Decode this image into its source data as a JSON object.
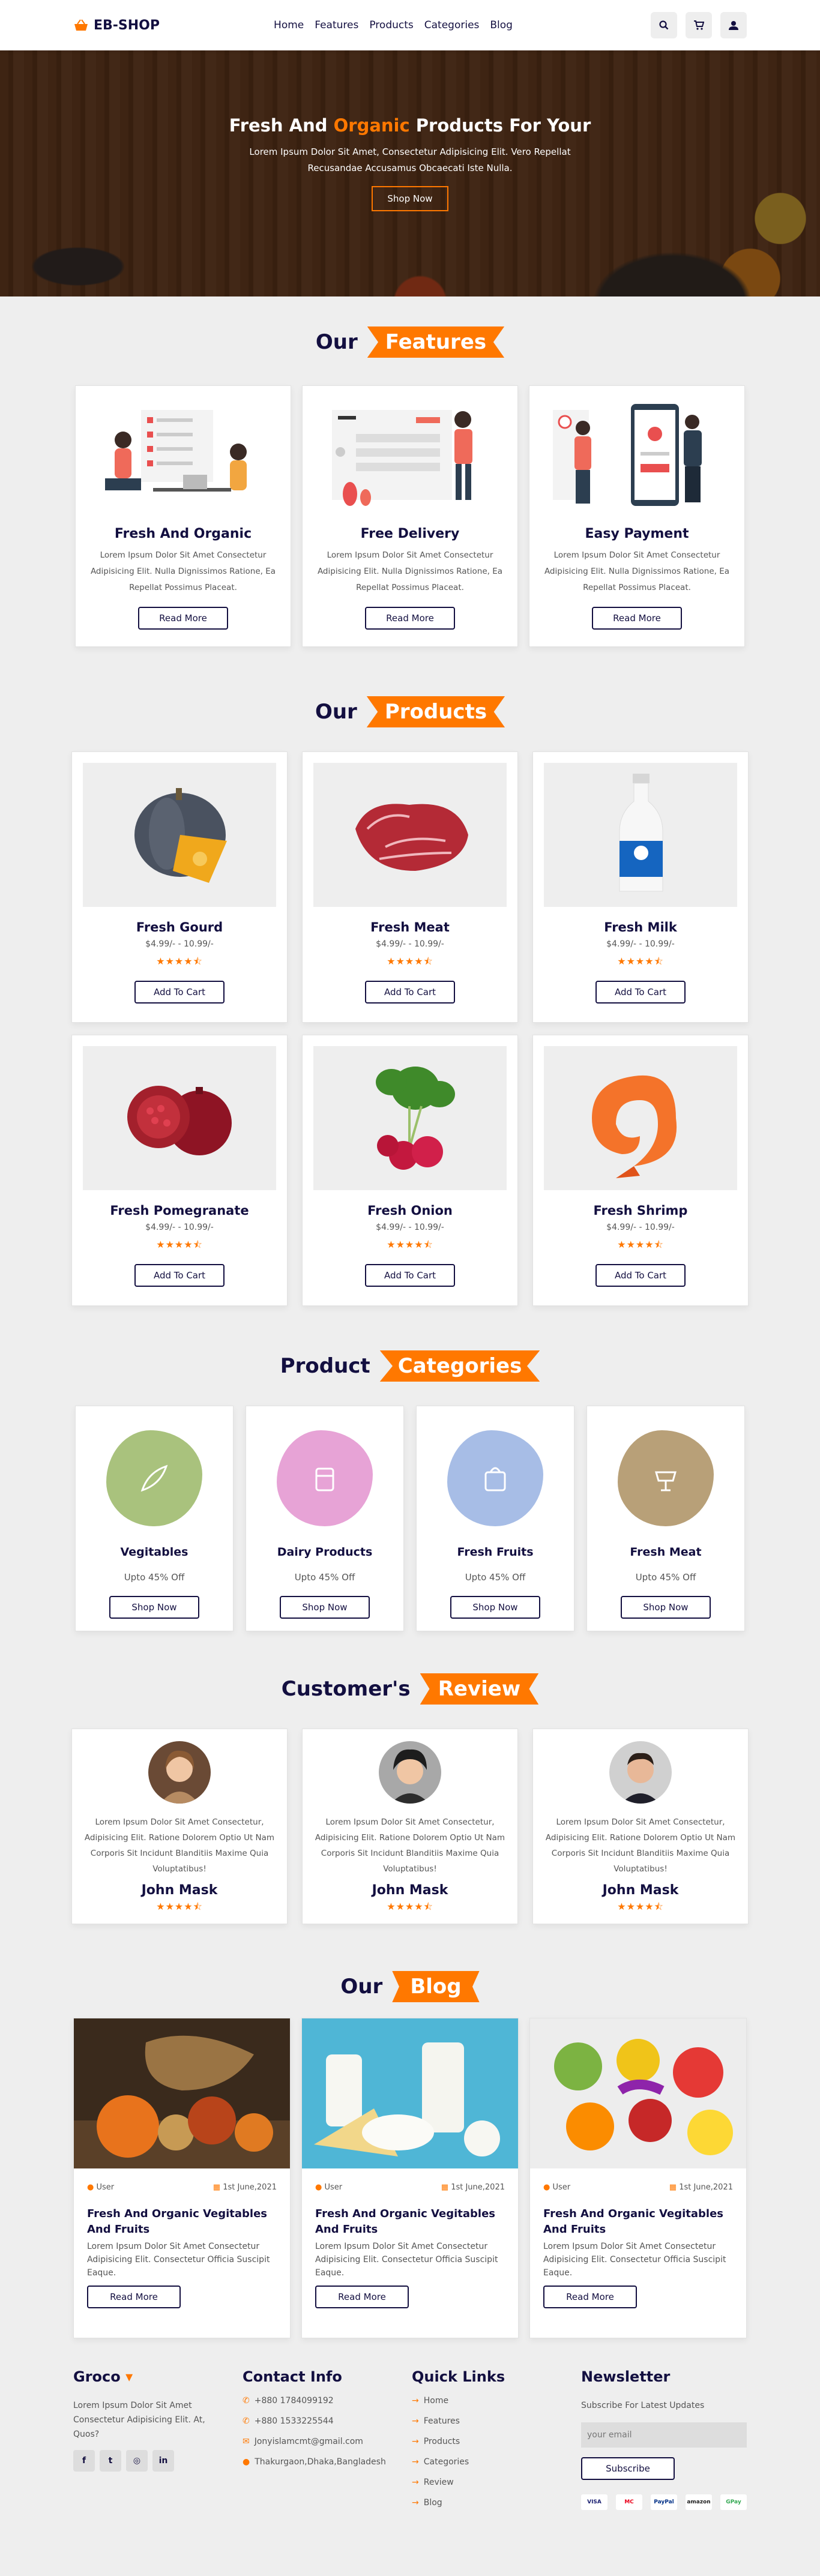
{
  "header": {
    "logo": "EB-SHOP",
    "nav": [
      "Home",
      "Features",
      "Products",
      "Categories",
      "Blog"
    ]
  },
  "hero": {
    "title_pre": "Fresh And ",
    "title_accent": "Organic",
    "title_post": " Products For Your",
    "text_line1": "Lorem Ipsum Dolor Sit Amet, Consectetur Adipisicing Elit. Vero Repellat",
    "text_line2": "Recusandae Accusamus Obcaecati Iste Nulla.",
    "button": "Shop Now"
  },
  "features": {
    "heading": "Our",
    "tag": "Features",
    "items": [
      {
        "title": "Fresh And Organic",
        "desc": "Lorem Ipsum Dolor Sit Amet Consectetur Adipisicing Elit. Nulla Dignissimos Ratione, Ea Repellat Possimus Placeat.",
        "button": "Read More"
      },
      {
        "title": "Free Delivery",
        "desc": "Lorem Ipsum Dolor Sit Amet Consectetur Adipisicing Elit. Nulla Dignissimos Ratione, Ea Repellat Possimus Placeat.",
        "button": "Read More"
      },
      {
        "title": "Easy Payment",
        "desc": "Lorem Ipsum Dolor Sit Amet Consectetur Adipisicing Elit. Nulla Dignissimos Ratione, Ea Repellat Possimus Placeat.",
        "button": "Read More"
      }
    ]
  },
  "products": {
    "heading": "Our",
    "tag": "Products",
    "items": [
      {
        "name": "Fresh Gourd",
        "price": "$4.99/- - 10.99/-",
        "stars": "★★★★⯪",
        "button": "Add To Cart"
      },
      {
        "name": "Fresh Meat",
        "price": "$4.99/- - 10.99/-",
        "stars": "★★★★⯪",
        "button": "Add To Cart"
      },
      {
        "name": "Fresh Milk",
        "price": "$4.99/- - 10.99/-",
        "stars": "★★★★⯪",
        "button": "Add To Cart"
      },
      {
        "name": "Fresh Pomegranate",
        "price": "$4.99/- - 10.99/-",
        "stars": "★★★★⯪",
        "button": "Add To Cart"
      },
      {
        "name": "Fresh Onion",
        "price": "$4.99/- - 10.99/-",
        "stars": "★★★★⯪",
        "button": "Add To Cart"
      },
      {
        "name": "Fresh Shrimp",
        "price": "$4.99/- - 10.99/-",
        "stars": "★★★★⯪",
        "button": "Add To Cart"
      }
    ]
  },
  "categories": {
    "heading": "Product",
    "tag": "Categories",
    "items": [
      {
        "name": "Vegitables",
        "offer": "Upto 45% Off",
        "button": "Shop Now",
        "color": "#a9c27d"
      },
      {
        "name": "Dairy Products",
        "offer": "Upto 45% Off",
        "button": "Shop Now",
        "color": "#e7a3d6"
      },
      {
        "name": "Fresh Fruits",
        "offer": "Upto 45% Off",
        "button": "Shop Now",
        "color": "#a7bde6"
      },
      {
        "name": "Fresh Meat",
        "offer": "Upto 45% Off",
        "button": "Shop Now",
        "color": "#b8a078"
      }
    ]
  },
  "reviews": {
    "heading": "Customer's",
    "tag": "Review",
    "items": [
      {
        "text": "Lorem Ipsum Dolor Sit Amet Consectetur, Adipisicing Elit. Ratione Dolorem Optio Ut Nam Corporis Sit Incidunt Blanditiis Maxime Quia Voluptatibus!",
        "name": "John Mask",
        "stars": "★★★★⯪"
      },
      {
        "text": "Lorem Ipsum Dolor Sit Amet Consectetur, Adipisicing Elit. Ratione Dolorem Optio Ut Nam Corporis Sit Incidunt Blanditiis Maxime Quia Voluptatibus!",
        "name": "John Mask",
        "stars": "★★★★⯪"
      },
      {
        "text": "Lorem Ipsum Dolor Sit Amet Consectetur, Adipisicing Elit. Ratione Dolorem Optio Ut Nam Corporis Sit Incidunt Blanditiis Maxime Quia Voluptatibus!",
        "name": "John Mask",
        "stars": "★★★★⯪"
      }
    ]
  },
  "blog": {
    "heading": "Our",
    "tag": "Blog",
    "items": [
      {
        "user": "User",
        "date": "1st June,2021",
        "title": "Fresh And Organic Vegitables And Fruits",
        "text": "Lorem Ipsum Dolor Sit Amet Consectetur Adipisicing Elit. Consectetur Officia Suscipit Eaque.",
        "button": "Read More"
      },
      {
        "user": "User",
        "date": "1st June,2021",
        "title": "Fresh And Organic Vegitables And Fruits",
        "text": "Lorem Ipsum Dolor Sit Amet Consectetur Adipisicing Elit. Consectetur Officia Suscipit Eaque.",
        "button": "Read More"
      },
      {
        "user": "User",
        "date": "1st June,2021",
        "title": "Fresh And Organic Vegitables And Fruits",
        "text": "Lorem Ipsum Dolor Sit Amet Consectetur Adipisicing Elit. Consectetur Officia Suscipit Eaque.",
        "button": "Read More"
      }
    ]
  },
  "footer": {
    "brand": "Groco",
    "about": "Lorem Ipsum Dolor Sit Amet Consectetur Adipisicing Elit. At, Quos?",
    "social": [
      "f",
      "t",
      "◎",
      "in"
    ],
    "contact_title": "Contact Info",
    "contact": [
      "+880 1784099192",
      "+880 1533225544",
      "Jonyislamcmt@gmail.com",
      "Thakurgaon,Dhaka,Bangladesh"
    ],
    "links_title": "Quick Links",
    "links": [
      "Home",
      "Features",
      "Products",
      "Categories",
      "Review",
      "Blog"
    ],
    "news_title": "Newsletter",
    "news_text": "Subscribe For Latest Updates",
    "email_placeholder": "your email",
    "subscribe": "Subscribe",
    "payments": [
      "VISA",
      "MC",
      "PayPal",
      "amazon",
      "GPay"
    ]
  },
  "colors": {
    "accent": "#ff7800",
    "navy": "#130f40"
  }
}
